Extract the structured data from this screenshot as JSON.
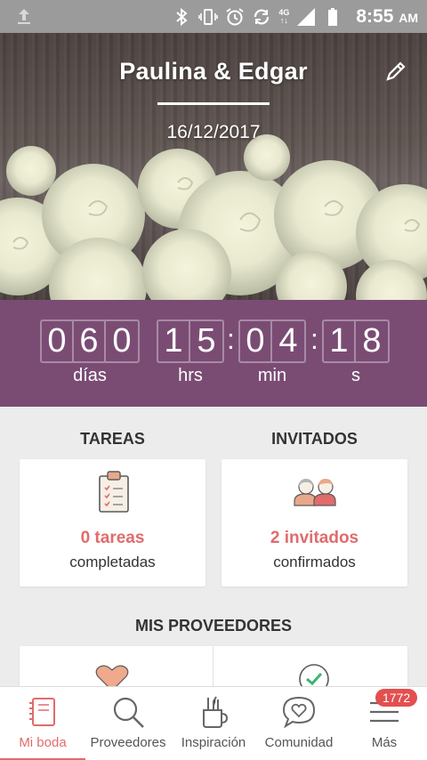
{
  "status_bar": {
    "time": "8:55",
    "ampm": "AM",
    "network": "4G",
    "icons": [
      "upload-icon",
      "bluetooth-icon",
      "vibrate-icon",
      "alarm-icon",
      "sync-icon",
      "signal-icon",
      "battery-icon"
    ]
  },
  "header": {
    "title": "Paulina & Edgar",
    "date": "16/12/2017",
    "edit_icon": "pencil-icon"
  },
  "countdown": {
    "days": [
      "0",
      "6",
      "0"
    ],
    "hours": [
      "1",
      "5"
    ],
    "minutes": [
      "0",
      "4"
    ],
    "seconds": [
      "1",
      "8"
    ],
    "separator": ":",
    "labels": {
      "days": "días",
      "hours": "hrs",
      "minutes": "min",
      "seconds": "s"
    },
    "background": "#7a4c74"
  },
  "tareas": {
    "title": "TAREAS",
    "count_text": "0 tareas",
    "status_text": "completadas",
    "icon": "clipboard-icon"
  },
  "invitados": {
    "title": "INVITADOS",
    "count_text": "2 invitados",
    "status_text": "confirmados",
    "icon": "couple-icon"
  },
  "proveedores": {
    "title": "MIS PROVEEDORES",
    "icons": [
      "heart-icon",
      "check-circle-icon"
    ]
  },
  "bottom_nav": {
    "items": [
      {
        "label": "Mi boda",
        "icon": "notebook-icon",
        "active": true
      },
      {
        "label": "Proveedores",
        "icon": "search-icon",
        "active": false
      },
      {
        "label": "Inspiración",
        "icon": "pencil-cup-icon",
        "active": false
      },
      {
        "label": "Comunidad",
        "icon": "chat-heart-icon",
        "active": false
      },
      {
        "label": "Más",
        "icon": "menu-icon",
        "active": false
      }
    ],
    "badge": "1772"
  },
  "colors": {
    "accent": "#e06c6c",
    "purple": "#7a4c74",
    "status_bar": "#9b9b9b"
  }
}
